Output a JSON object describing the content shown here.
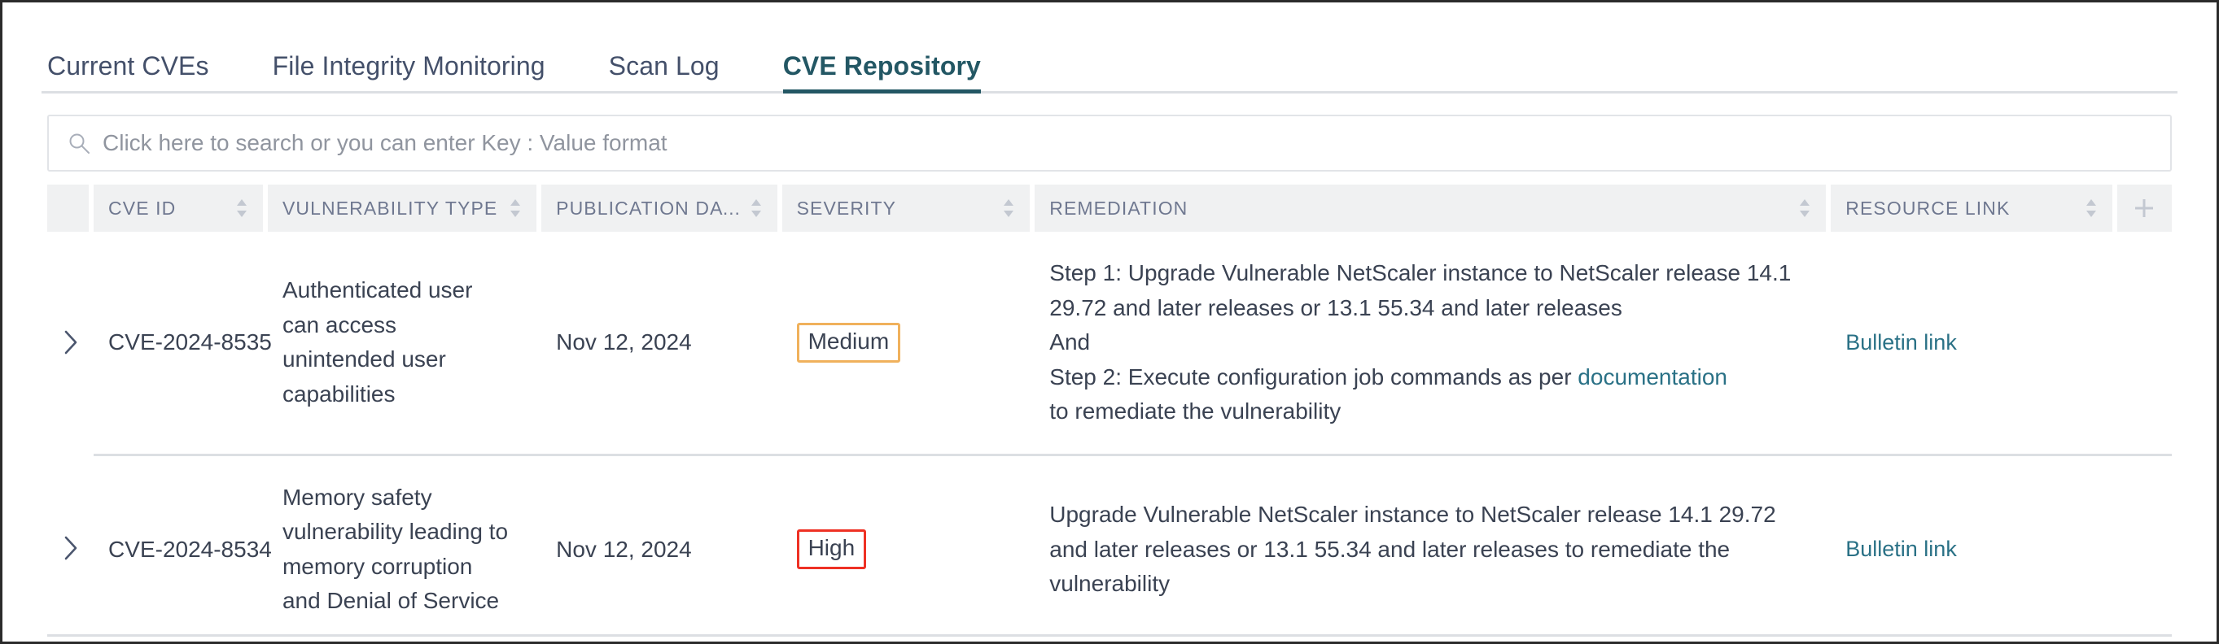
{
  "tabs": [
    {
      "label": "Current CVEs",
      "active": false
    },
    {
      "label": "File Integrity Monitoring",
      "active": false
    },
    {
      "label": "Scan Log",
      "active": false
    },
    {
      "label": "CVE Repository",
      "active": true
    }
  ],
  "search": {
    "value": "",
    "placeholder": "Click here to search or you can enter Key : Value format",
    "icon": "search-icon"
  },
  "table": {
    "add_column_icon": "plus-icon",
    "columns": [
      {
        "key": "expand",
        "label": "",
        "sortable": false
      },
      {
        "key": "cve_id",
        "label": "CVE ID",
        "sortable": true
      },
      {
        "key": "vulnerability_type",
        "label": "VULNERABILITY TYPE",
        "sortable": true
      },
      {
        "key": "publication_date",
        "label": "PUBLICATION DATE",
        "sortable": true
      },
      {
        "key": "severity",
        "label": "SEVERITY",
        "sortable": true
      },
      {
        "key": "remediation",
        "label": "REMEDIATION",
        "sortable": true
      },
      {
        "key": "resource_link",
        "label": "RESOURCE LINK",
        "sortable": true
      }
    ],
    "rows": [
      {
        "expand_icon": "chevron-right-icon",
        "cve_id": "CVE-2024-8535",
        "vulnerability_type": "Authenticated user can access unintended user capabilities",
        "publication_date": "Nov 12, 2024",
        "severity": {
          "label": "Medium",
          "level": "medium",
          "border_color": "#f0b15c"
        },
        "remediation_lines": [
          {
            "text": "Step 1: Upgrade Vulnerable NetScaler instance to NetScaler release 14.1 29.72 and later releases or 13.1 55.34 and later releases",
            "link": null
          },
          {
            "text": "And",
            "link": null
          },
          {
            "text": "Step 2: Execute configuration job commands as per ",
            "link": "documentation",
            "text_after": ""
          },
          {
            "text": "to remediate the vulnerability",
            "link": null
          }
        ],
        "resource_link": "Bulletin link"
      },
      {
        "expand_icon": "chevron-right-icon",
        "cve_id": "CVE-2024-8534",
        "vulnerability_type": "Memory safety vulnerability leading to memory corruption and Denial of Service",
        "publication_date": "Nov 12, 2024",
        "severity": {
          "label": "High",
          "level": "high",
          "border_color": "#ee3124"
        },
        "remediation_lines": [
          {
            "text": "Upgrade Vulnerable NetScaler instance to NetScaler release 14.1 29.72 and later releases or 13.1 55.34 and later releases to remediate the vulnerability",
            "link": null
          }
        ],
        "resource_link": "Bulletin link"
      }
    ]
  },
  "colors": {
    "active_tab": "#235764",
    "inactive_tab": "#44506a",
    "link": "#2a7186",
    "header_bg": "#f0f1f2",
    "header_text": "#6f7890",
    "severity_high": "#ee3124",
    "severity_medium": "#f0b15c",
    "divider": "#dcdfe3"
  }
}
